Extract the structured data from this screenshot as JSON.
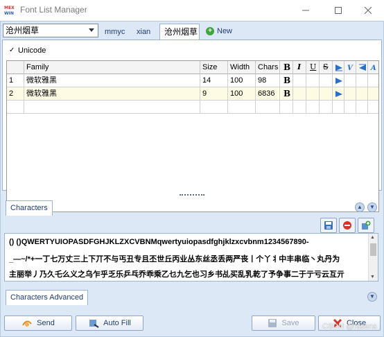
{
  "window": {
    "title": "Font List Manager",
    "app_icon_text": "MEX WIN"
  },
  "toolbar": {
    "font_select_value": "沧州烟草",
    "tabs": [
      "mmyc",
      "xian",
      "沧州烟草"
    ],
    "new_label": "New"
  },
  "options": {
    "unicode_label": "Unicode",
    "unicode_checked": "✓"
  },
  "grid": {
    "columns": [
      "Family",
      "Size",
      "Width",
      "Chars"
    ],
    "style_glyphs": [
      "B",
      "I",
      "U",
      "S"
    ],
    "rows": [
      {
        "num": "1",
        "family": "微软雅黑",
        "size": "14",
        "width": "100",
        "chars": "98",
        "bold": "B"
      },
      {
        "num": "2",
        "family": "微软雅黑",
        "size": "9",
        "width": "100",
        "chars": "6836",
        "bold": "B"
      }
    ]
  },
  "characters": {
    "section_label": "Characters",
    "lines": [
      "() ()QWERTYUIOPASDFGHJKLZXCVBNMqwertyuiopasdfghjklzxcvbnm1234567890-",
      "_—~/*+一丁七万丈三上下丌不与丐丑专且丕世丘丙业丛东丝丞丢两严丧丨个丫丬中丰串临丶丸丹为",
      "主丽举丿乃久乇么义之乌乍乎乏乐乒乓乔乖乘乙乜九乞也习乡书乩买乱乳乾了予争事二于亍亏云互亓"
    ]
  },
  "advanced": {
    "section_label": "Characters Advanced"
  },
  "buttons": {
    "send": "Send",
    "autofill": "Auto Fill",
    "save": "Save",
    "close": "Close"
  },
  "watermark": "CSDN @rasens"
}
